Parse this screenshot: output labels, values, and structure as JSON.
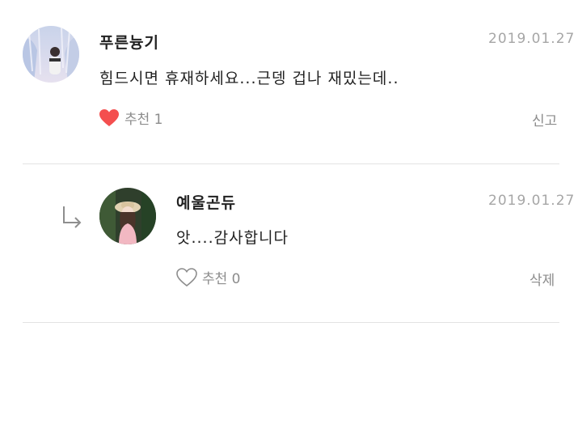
{
  "comments": [
    {
      "author": "푸른늉기",
      "date": "2019.01.27",
      "text": "힘드시면 휴재하세요...근뎅 겁나 재밌는데..",
      "like_label": "추천 1",
      "liked": true,
      "action_label": "신고",
      "like_icon": "heart-filled-icon"
    },
    {
      "author": "예울곤듀",
      "date": "2019.01.27",
      "text": "앗....감사합니다",
      "like_label": "추천 0",
      "liked": false,
      "action_label": "삭제",
      "like_icon": "heart-outline-icon",
      "is_reply": true
    }
  ],
  "colors": {
    "heart_filled": "#f44f4f",
    "heart_outline": "#8c8c8c",
    "muted_text": "#8c8c8c",
    "date_text": "#a6a6a6",
    "divider": "#e3e3e3"
  }
}
